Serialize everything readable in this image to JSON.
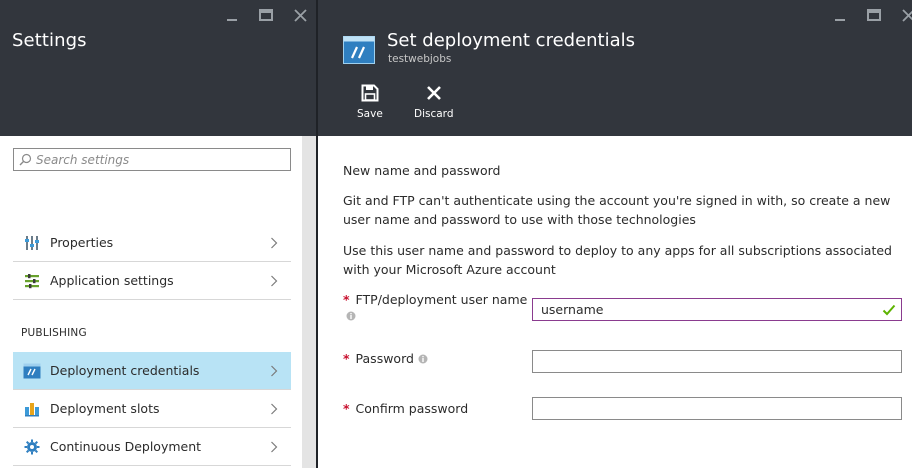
{
  "settings_blade": {
    "title": "Settings",
    "search": {
      "placeholder": "Search settings",
      "value": ""
    },
    "items": [
      {
        "label": "Properties",
        "icon": "properties-icon"
      },
      {
        "label": "Application settings",
        "icon": "app-settings-icon"
      }
    ],
    "section_publishing": "PUBLISHING",
    "publishing_items": [
      {
        "label": "Deployment credentials",
        "icon": "deployment-credentials-icon",
        "selected": true
      },
      {
        "label": "Deployment slots",
        "icon": "deployment-slots-icon"
      },
      {
        "label": "Continuous Deployment",
        "icon": "continuous-deployment-icon"
      }
    ]
  },
  "credentials_blade": {
    "title": "Set deployment credentials",
    "subtitle": "testwebjobs",
    "commands": {
      "save": "Save",
      "discard": "Discard"
    },
    "heading": "New name and password",
    "paragraph1": "Git and FTP can't authenticate using the account you're signed in with, so create a new user name and password to use with those technologies",
    "paragraph2": "Use this user name and password to deploy to any apps for all subscriptions associated with your Microsoft Azure account",
    "fields": {
      "username": {
        "label": "FTP/deployment user name",
        "value": "username",
        "required": "*"
      },
      "password": {
        "label": "Password",
        "value": "",
        "required": "*"
      },
      "confirm": {
        "label": "Confirm password",
        "value": "",
        "required": "*"
      }
    }
  },
  "colors": {
    "header_bg": "#32363d",
    "selected_bg": "#b8e3f5",
    "required": "#c8102e",
    "valid_check": "#5db300",
    "valid_border": "#8a3b8f"
  }
}
